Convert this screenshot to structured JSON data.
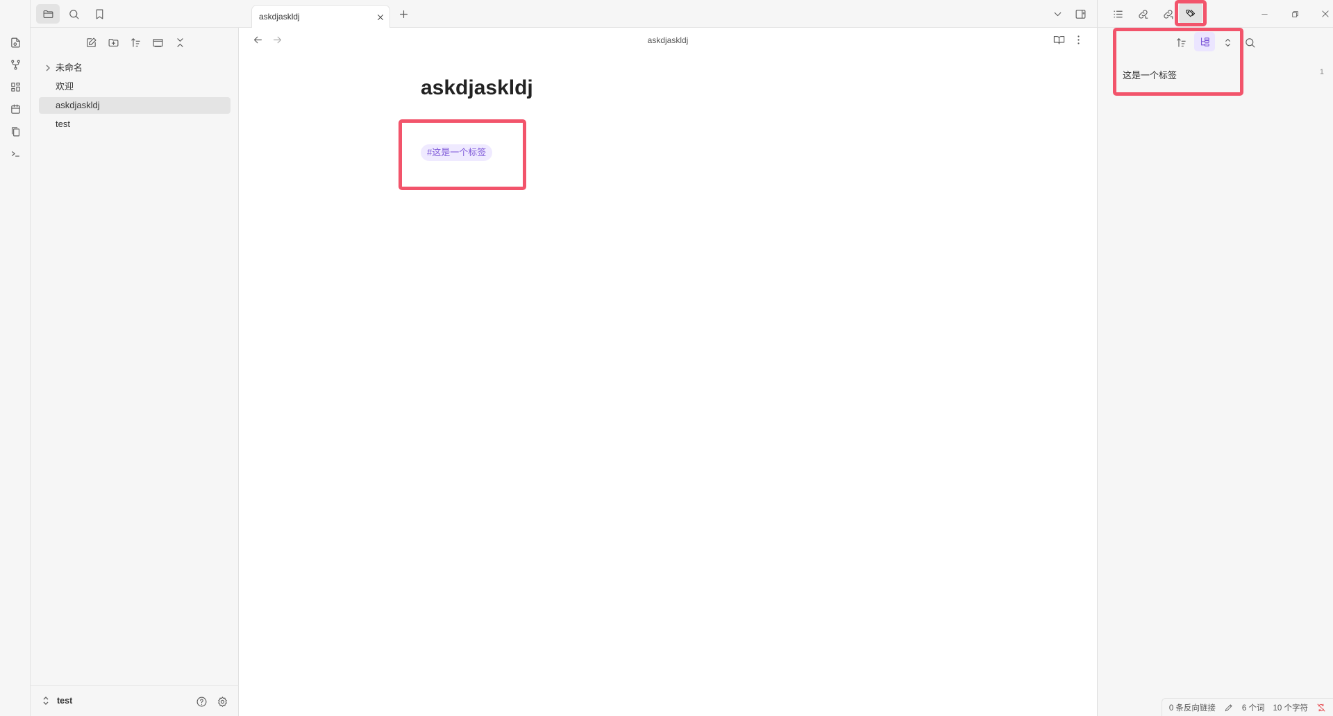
{
  "left_sidebar": {
    "tree": [
      {
        "label": "未命名",
        "type": "folder"
      },
      {
        "label": "欢迎",
        "type": "file"
      },
      {
        "label": "askdjaskldj",
        "type": "file",
        "active": true
      },
      {
        "label": "test",
        "type": "file"
      }
    ],
    "vault_name": "test"
  },
  "tabs": [
    {
      "title": "askdjaskldj"
    }
  ],
  "editor": {
    "nav_title": "askdjaskldj",
    "doc_title": "askdjaskldj",
    "tag": "#这是一个标签"
  },
  "right_sidebar": {
    "tags": [
      {
        "name": "这是一个标签",
        "count": "1"
      }
    ]
  },
  "status_bar": {
    "backlinks": "0 条反向链接",
    "words": "6 个词",
    "chars": "10 个字符"
  },
  "colors": {
    "accent": "#7f5ad9",
    "tag_bg": "#efeaff",
    "highlight": "#f2546b"
  }
}
